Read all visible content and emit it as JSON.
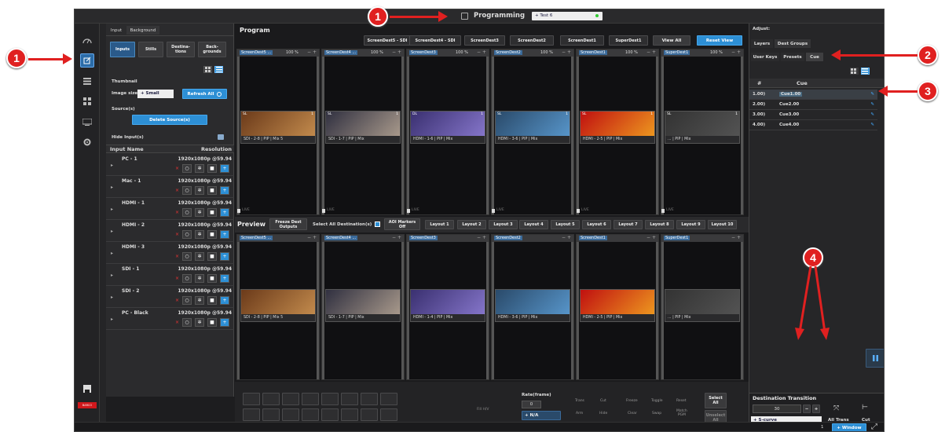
{
  "titlebar": {
    "title": "Programming",
    "preset": "+ Test 6"
  },
  "leftbar": {
    "icons": [
      "dashboard-icon",
      "edit-icon",
      "list-icon",
      "grid-icon",
      "keyboard-icon",
      "settings-icon",
      "save-icon"
    ],
    "brand": "BARCO"
  },
  "inputs_panel": {
    "tabs": [
      "Input",
      "Background"
    ],
    "subtabs": [
      "Inputs",
      "Stills",
      "Destina-\ntions",
      "Back-\ngrounds"
    ],
    "thumbnail_label": "Thumbnail",
    "image_size_label": "Image size",
    "image_size_value": "+ Small",
    "refresh_label": "Refresh All",
    "sources_label": "Source(s)",
    "delete_label": "Delete Source(s)",
    "hide_label": "Hide Input(s)",
    "col_name": "Input Name",
    "col_res": "Resolution",
    "rows": [
      {
        "name": "PC - 1",
        "res": "1920x1080p @59.94"
      },
      {
        "name": "Mac - 1",
        "res": "1920x1080p @59.94"
      },
      {
        "name": "HDMI - 1",
        "res": "1920x1080p @59.94"
      },
      {
        "name": "HDMI - 2",
        "res": "1920x1080p @59.94"
      },
      {
        "name": "HDMI - 3",
        "res": "1920x1080p @59.94"
      },
      {
        "name": "SDI - 1",
        "res": "1920x1080p @59.94"
      },
      {
        "name": "SDI - 2",
        "res": "1920x1080p @59.94"
      },
      {
        "name": "PC - Black",
        "res": "1920x1080p @59.94"
      }
    ]
  },
  "program": {
    "title": "Program",
    "dest_buttons": [
      "ScreenDest5 - SDI",
      "ScreenDest4 - SDI",
      "ScreenDest3",
      "ScreenDest2",
      "ScreenDest1",
      "SuperDest1"
    ],
    "view_all": "View All",
    "reset_view": "Reset View",
    "tiles": [
      {
        "name": "ScreenDest5 ...",
        "zoom": "100 %",
        "caption": "SDI - 2-8 | PIP | Mix 5",
        "tag": "SL",
        "num": "1"
      },
      {
        "name": "ScreenDest4 ...",
        "zoom": "100 %",
        "caption": "SDI - 1-7 | PIP | Mix",
        "tag": "SL",
        "num": "1"
      },
      {
        "name": "ScreenDest3",
        "zoom": "100 %",
        "caption": "HDMI - 1-6 | PIP | Mix",
        "tag": "DL",
        "num": "1"
      },
      {
        "name": "ScreenDest2",
        "zoom": "100 %",
        "caption": "HDMI - 3-6 | PIP | Mix",
        "tag": "SL",
        "num": "1"
      },
      {
        "name": "ScreenDest1",
        "zoom": "100 %",
        "caption": "HDMI - 2-5 | PIP | Mix",
        "tag": "SL",
        "num": "1"
      },
      {
        "name": "SuperDest1",
        "zoom": "100 %",
        "caption": "... | PIP | Mix",
        "tag": "SL",
        "num": "1"
      }
    ],
    "live": "LIVE"
  },
  "preview": {
    "title": "Preview",
    "freeze": "Freeze Dest\nOutputs",
    "select_all": "Select All Destination(s)",
    "aoi": "AOI Markers\nOff",
    "layouts": [
      "Layout 1",
      "Layout 2",
      "Layout 3",
      "Layout 4",
      "Layout 5",
      "Layout 6",
      "Layout 7",
      "Layout 8",
      "Layout 9",
      "Layout 10"
    ],
    "tiles": [
      {
        "name": "ScreenDest5 ...",
        "caption": "SDI - 2-8 | PIP | Mix 5"
      },
      {
        "name": "ScreenDest4 ...",
        "caption": "SDI - 1-7 | PIP | Mix"
      },
      {
        "name": "ScreenDest3",
        "caption": "HDMI - 1-4 | PIP | Mix"
      },
      {
        "name": "ScreenDest2",
        "caption": "HDMI - 3-6 | PIP | Mix"
      },
      {
        "name": "ScreenDest1",
        "caption": "HDMI - 2-5 | PIP | Mix"
      },
      {
        "name": "SuperDest1",
        "caption": "... | PIP | Mix"
      }
    ]
  },
  "bottom_toolbar": {
    "rate_label": "Rate(frame)",
    "rate_value": "0",
    "na": "+ N/A",
    "fill": "Fill H/V",
    "trans": "Trans",
    "cut": "Cut",
    "arm": "Arm",
    "hide": "Hide",
    "freeze": "Freeze",
    "toggle": "Toggle",
    "reset": "Reset",
    "clear": "Clear",
    "swap": "Swap",
    "match": "Match\nPGM",
    "select_all": "Select\nAll",
    "unselect_all": "Unselect\nAll"
  },
  "adjust_panel": {
    "title": "Adjust:",
    "tabs": [
      "Layers",
      "Dest Groups"
    ],
    "subtabs": [
      "User Keys",
      "Presets",
      "Cue"
    ],
    "col_num": "#",
    "col_cue": "Cue",
    "cues": [
      {
        "num": "1.00)",
        "name": "Cue1.00"
      },
      {
        "num": "2.00)",
        "name": "Cue2.00"
      },
      {
        "num": "3.00)",
        "name": "Cue3.00"
      },
      {
        "num": "4.00)",
        "name": "Cue4.00"
      }
    ],
    "transition_title": "Destination Transition",
    "transition_value": "30",
    "curve": "+ S-curve",
    "all_trans": "All Trans",
    "cut": "Cut"
  },
  "statusbar": {
    "page": "1",
    "window": "+ Window"
  },
  "callouts": [
    "1",
    "1",
    "2",
    "3",
    "4"
  ]
}
